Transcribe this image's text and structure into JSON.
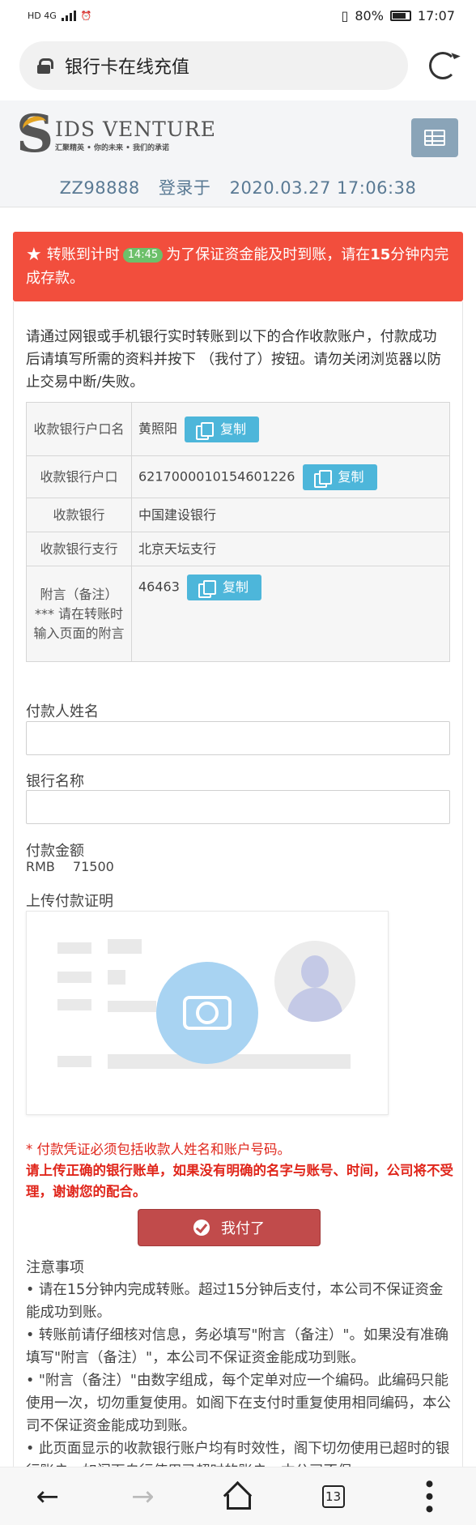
{
  "status_bar": {
    "network": "HD 4G",
    "battery": "80%",
    "time": "17:07"
  },
  "browser": {
    "url_title": "银行卡在线充值",
    "reload_icon": "reload-icon"
  },
  "header": {
    "logo_title": "IDS VENTURE",
    "logo_tagline": "汇聚精英 • 你的未来 • 我们的承诺",
    "menu_icon": "menu-icon",
    "account_id": "ZZ98888",
    "login_label": "登录于",
    "login_time": "2020.03.27 17:06:38"
  },
  "alert": {
    "prefix": "转账到计时",
    "timer": "14:45",
    "text_before": "为了保证资金能及时到账，请在",
    "minutes": "15",
    "text_after": "分钟内完成存款。"
  },
  "intro": "请通过网银或手机银行实时转账到以下的合作收款账户，付款成功后请填写所需的资料并按下 （我付了）按钮。请勿关闭浏览器以防止交易中断/失败。",
  "account_table": {
    "rows": [
      {
        "label": "收款银行户口名",
        "value": "黄照阳",
        "copy": "复制"
      },
      {
        "label": "收款银行户口",
        "value": "6217000010154601226",
        "copy": "复制"
      },
      {
        "label": "收款银行",
        "value": "中国建设银行"
      },
      {
        "label": "收款银行支行",
        "value": "北京天坛支行"
      },
      {
        "label": "附言（备注） *** 请在转账时输入页面的附言",
        "value": "46463",
        "copy": "复制"
      }
    ]
  },
  "form": {
    "payer_name_label": "付款人姓名",
    "payer_name_value": "",
    "bank_name_label": "银行名称",
    "bank_name_value": "",
    "amount_label": "付款金额",
    "currency": "RMB",
    "amount": "71500",
    "upload_label": "上传付款证明"
  },
  "warnings": {
    "line1": "* 付款凭证必须包括收款人姓名和账户号码。",
    "line2": "请上传正确的银行账单，如果没有明确的名字与账号、时间，公司将不受理，谢谢您的配合。"
  },
  "pay_button": "我付了",
  "notes": {
    "title": "注意事项",
    "items": [
      "• 请在15分钟内完成转账。超过15分钟后支付，本公司不保证资金能成功到账。",
      "• 转账前请仔细核对信息，务必填写\"附言（备注）\"。如果没有准确填写\"附言（备注）\"，本公司不保证资金能成功到账。",
      "• \"附言（备注）\"由数字组成，每个定单对应一个编码。此编码只能使用一次，切勿重复使用。如阁下在支付时重复使用相同编码，本公司不保证资金能成功到账。",
      "• 此页面显示的收款银行账户均有时效性，阁下切勿使用已超时的银行账户，如阁下自行使用已超时的账户，本公司不保"
    ]
  },
  "bottom_nav": {
    "tab_count": "13"
  }
}
